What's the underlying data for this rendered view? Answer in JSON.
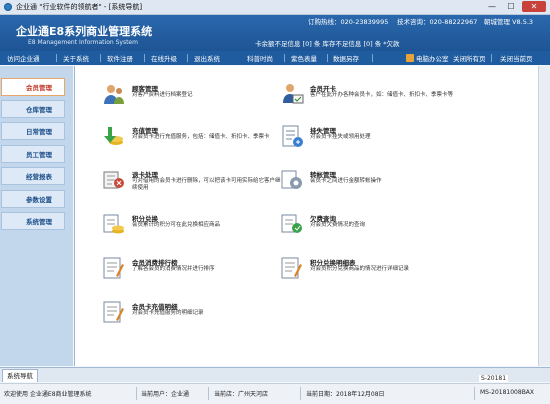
{
  "window": {
    "title": "企业通 \"行业软件的领航者\" - [系统导航]",
    "min_glyph": "—",
    "max_glyph": "☐",
    "close_glyph": "✕"
  },
  "header": {
    "brand": "企业通E8系列商业管理系统",
    "brand_sub": "E8 Management Information System",
    "order_hotline": "订购热线：020-23839995",
    "support_hotline": "技术咨询：020-88222967",
    "version": "朝城管理 V8.5.3",
    "alerts": "卡余额不足信息 [0] 条  库存不足信息 [0] 条 *欠款"
  },
  "nav": {
    "items": [
      "访问企业通",
      "关于系统",
      "软件注册",
      "在线升级",
      "退出系统",
      "科普时尚",
      "紫色表量",
      "数据另存",
      "电脑办公室",
      "关闭所有页",
      "关闭当前页"
    ]
  },
  "sidebar": {
    "items": [
      {
        "label": "会员管理",
        "active": true
      },
      {
        "label": "仓库管理",
        "active": false
      },
      {
        "label": "日常管理",
        "active": false
      },
      {
        "label": "员工管理",
        "active": false
      },
      {
        "label": "经营报表",
        "active": false
      },
      {
        "label": "参数设置",
        "active": false
      },
      {
        "label": "系统管理",
        "active": false
      }
    ]
  },
  "cards": [
    {
      "title": "顾客管理",
      "desc": "对客户资料进行档案登记",
      "icon": "customer-icon"
    },
    {
      "title": "会员开卡",
      "desc": "客户在此开办各种会员卡，如：储值卡、折扣卡、季票卡等",
      "icon": "open-card-icon"
    },
    {
      "title": "充值管理",
      "desc": "对会员卡进行充值服务，包括：储值卡、折扣卡、季票卡",
      "icon": "recharge-icon"
    },
    {
      "title": "挂失管理",
      "desc": "对会员卡挂失或领用处理",
      "icon": "loss-icon"
    },
    {
      "title": "退卡处理",
      "desc": "可对借用的会员卡进行删除，可以把该卡可用实际给它客户继续使用",
      "icon": "refund-icon"
    },
    {
      "title": "转帐管理",
      "desc": "会员卡之间进行金额转帐操作",
      "icon": "transfer-icon"
    },
    {
      "title": "积分兑换",
      "desc": "会员累计的积分可在此兑换相应商品",
      "icon": "points-icon"
    },
    {
      "title": "欠费查询",
      "desc": "对会员欠费情况的查询",
      "icon": "arrears-icon"
    },
    {
      "title": "会员消费排行榜",
      "desc": "了解各会员的消费情况并进行排序",
      "icon": "ranking-icon"
    },
    {
      "title": "积分兑换明细表",
      "desc": "对会员积分兑换商品的情况进行详细记录",
      "icon": "points-detail-icon"
    },
    {
      "title": "会员卡充值明细",
      "desc": "对会员卡充值服务的明细记录",
      "icon": "recharge-detail-icon"
    }
  ],
  "tabbar": {
    "active_tab": "系统导航"
  },
  "statusbar": {
    "welcome": "欢迎使用 企业通E8商业管理系统",
    "current_user": "当前用户：企业通",
    "branch": "当前店：广州天河店",
    "date": "当前日期：2018年12月08日",
    "machine": "MS-20181008BAX",
    "ime": "S-20181"
  },
  "colors": {
    "banner": "#1f5b9f",
    "sidebar": "#c2d6ec",
    "active_item": "#c0392b"
  }
}
